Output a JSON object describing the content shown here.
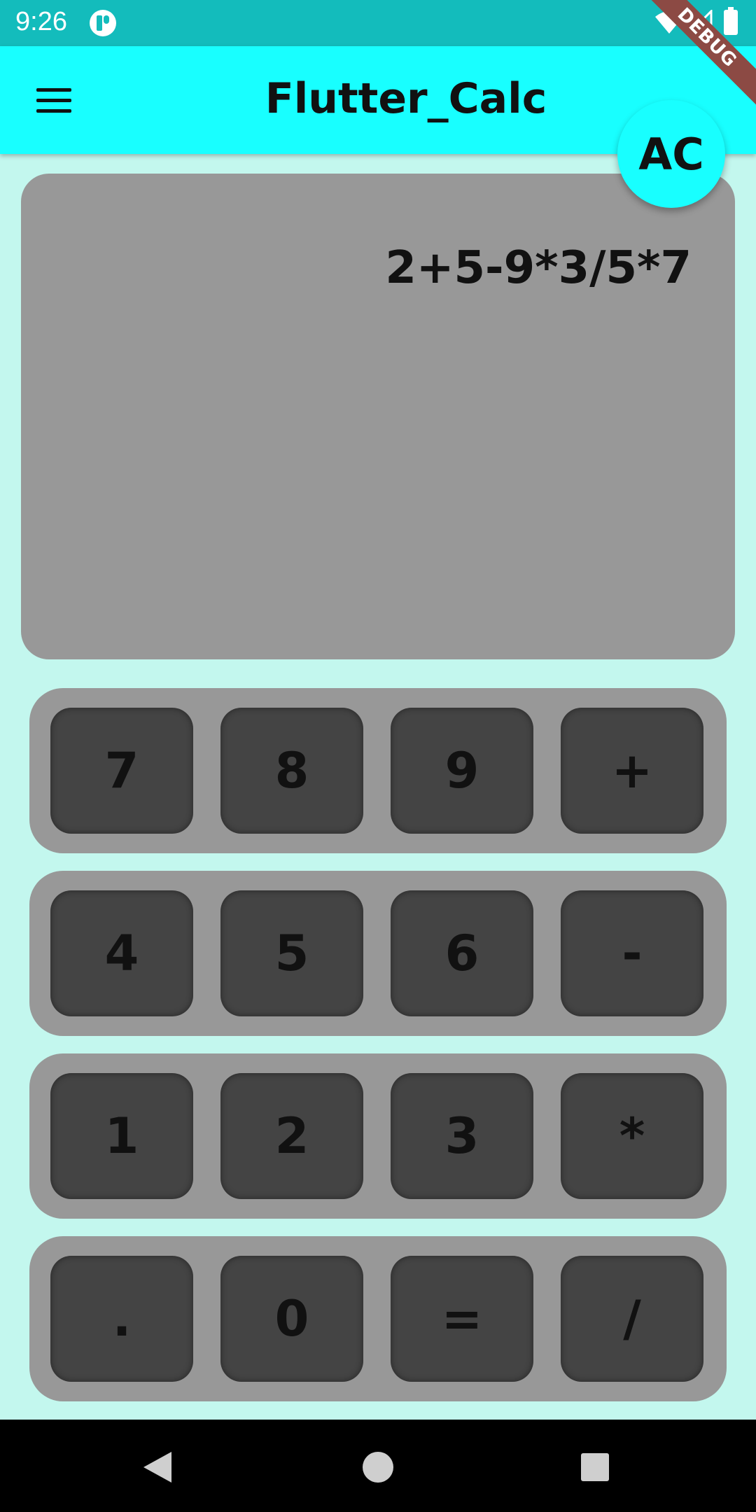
{
  "status_bar": {
    "time": "9:26",
    "icons": [
      "app-notification-icon",
      "wifi-icon",
      "signal-icon",
      "battery-icon"
    ]
  },
  "app_bar": {
    "title": "Flutter_Calc",
    "menu_icon": "hamburger-menu-icon",
    "debug_banner": "DEBUG"
  },
  "ac_button": {
    "label": "AC"
  },
  "display": {
    "expression": "2+5-9*3/5*7"
  },
  "keypad": {
    "rows": [
      [
        "7",
        "8",
        "9",
        "+"
      ],
      [
        "4",
        "5",
        "6",
        "-"
      ],
      [
        "1",
        "2",
        "3",
        "*"
      ],
      [
        ".",
        "0",
        "=",
        "/"
      ]
    ]
  },
  "nav_bar": {
    "icons": [
      "back-icon",
      "home-icon",
      "recents-icon"
    ]
  },
  "colors": {
    "status_bar": "#13bcbc",
    "app_bar": "#18ffff",
    "background": "#c3f7ee",
    "panel": "#989898",
    "key": "#444444"
  }
}
